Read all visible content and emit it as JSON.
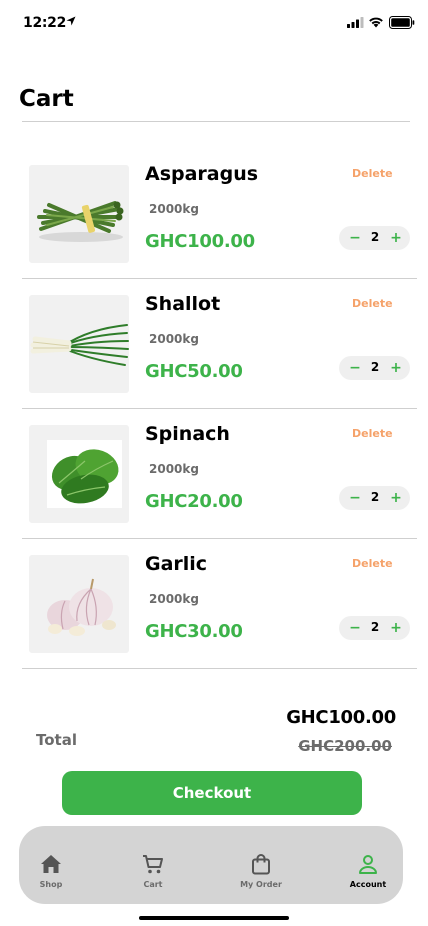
{
  "status_bar": {
    "time": "12:22"
  },
  "page": {
    "title": "Cart"
  },
  "cart": {
    "delete_label": "Delete",
    "minus_label": "−",
    "plus_label": "+",
    "items": [
      {
        "name": "Asparagus",
        "weight": "2000kg",
        "price": "GHC100.00",
        "quantity": "2"
      },
      {
        "name": "Shallot",
        "weight": "2000kg",
        "price": "GHC50.00",
        "quantity": "2"
      },
      {
        "name": "Spinach",
        "weight": "2000kg",
        "price": "GHC20.00",
        "quantity": "2"
      },
      {
        "name": "Garlic",
        "weight": "2000kg",
        "price": "GHC30.00",
        "quantity": "2"
      }
    ]
  },
  "summary": {
    "total_label": "Total",
    "total_amount": "GHC100.00",
    "original_amount": "GHC200.00"
  },
  "checkout": {
    "label": "Checkout"
  },
  "nav": {
    "items": [
      {
        "label": "Shop",
        "icon": "home-icon"
      },
      {
        "label": "Cart",
        "icon": "cart-icon"
      },
      {
        "label": "My Order",
        "icon": "bag-icon"
      },
      {
        "label": "Account",
        "icon": "user-icon",
        "active": true
      }
    ]
  },
  "colors": {
    "accent": "#3db34a",
    "delete": "#f5a26a",
    "nav_bg": "#d4d4d4"
  }
}
